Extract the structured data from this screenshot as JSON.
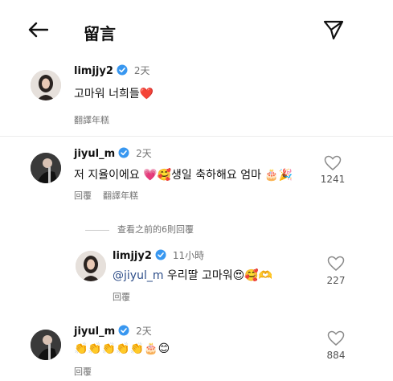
{
  "header": {
    "title": "留言",
    "back_icon": "arrow-left-icon",
    "send_icon": "paper-plane-icon"
  },
  "comments": [
    {
      "username": "limjjy2",
      "time": "2天",
      "text": "고마워 너희들❤️",
      "actions": [
        "翻譯年糕"
      ]
    },
    {
      "username": "jiyul_m",
      "time": "2天",
      "text": "저 지율이에요 💗🥰생일 축하해요 엄마 🎂🎉",
      "likes": "1241",
      "actions": [
        "回覆",
        "翻譯年糕"
      ]
    },
    {
      "username": "jiyul_m",
      "time": "2天",
      "text": "👏👏👏👏👏🎂😊",
      "likes": "884",
      "actions": [
        "回覆"
      ]
    }
  ],
  "view_replies": "查看之前的6則回覆",
  "reply": {
    "username": "limjjy2",
    "time": "11小時",
    "mention": "@jiyul_m",
    "text": "우리딸 고마워😍🥰🫶",
    "likes": "227",
    "actions": [
      "回覆"
    ]
  },
  "colors": {
    "verified": "#3897f0",
    "muted": "#737373",
    "mention": "#2f4f8a"
  }
}
